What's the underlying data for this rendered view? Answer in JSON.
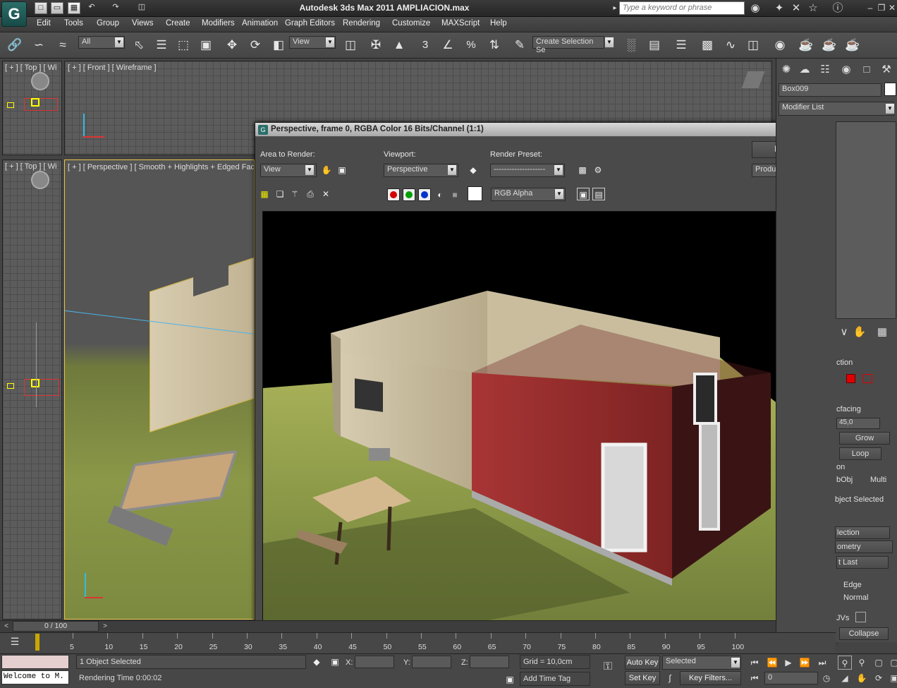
{
  "app": {
    "title": "Autodesk 3ds Max  2011      AMPLIACION.max",
    "logo_glyph": "G",
    "search_placeholder": "Type a keyword or phrase"
  },
  "menu": [
    "Edit",
    "Tools",
    "Group",
    "Views",
    "Create",
    "Modifiers",
    "Animation",
    "Graph Editors",
    "Rendering",
    "Customize",
    "MAXScript",
    "Help"
  ],
  "toolbar": {
    "selection_filter": "All",
    "ref_coord": "View",
    "named_selection": "Create Selection Se",
    "snap_3": "3",
    "snap_percent": "%"
  },
  "viewports": {
    "top_left_label": "[ + ] [ Top ] [ Wi",
    "front_label": "[ + ] [ Front ] [ Wireframe ]",
    "left_label": "[ + ] [ Top ] [ Wi",
    "perspective_label": "[ + ] [ Perspective ] [ Smooth + Highlights + Edged Faces ]"
  },
  "render_frame": {
    "title": "Perspective, frame 0, RGBA Color 16 Bits/Channel (1:1)",
    "area_to_render_label": "Area to Render:",
    "area_to_render_value": "View",
    "viewport_label": "Viewport:",
    "viewport_value": "Perspective",
    "render_preset_label": "Render Preset:",
    "render_preset_value": "--------------------",
    "render_button": "Render",
    "production_value": "Production",
    "channel_value": "RGB Alpha"
  },
  "command_panel": {
    "object_name": "Box009",
    "modifier_list": "Modifier List",
    "selection_rollout": "ction",
    "backfacing": "cfacing",
    "threshold": "45,0",
    "grow": "Grow",
    "loop": "Loop",
    "on": "on",
    "by_obj": "bObj",
    "multi": "Multi",
    "object_selected": "bject Selected",
    "soft_selection": "lection",
    "edit_geometry": "ometry",
    "repeat_last": "t Last",
    "edge": "Edge",
    "normal": "Normal",
    "uvs": "JVs",
    "collapse": "Collapse"
  },
  "timeline": {
    "frame_counter": "0 / 100",
    "ticks": [
      "5",
      "10",
      "15",
      "20",
      "25",
      "30",
      "35",
      "40",
      "45",
      "50",
      "55",
      "60",
      "65",
      "70",
      "75",
      "80",
      "85",
      "90",
      "95",
      "100"
    ]
  },
  "status": {
    "maxscript_listener": "Welcome to M.",
    "selection_status": "1 Object Selected",
    "rendering_time": "Rendering Time  0:00:02",
    "x_label": "X:",
    "y_label": "Y:",
    "z_label": "Z:",
    "grid": "Grid = 10,0cm",
    "add_time_tag": "Add Time Tag",
    "auto_key": "Auto Key",
    "set_key": "Set Key",
    "key_mode": "Selected",
    "key_filters": "Key Filters...",
    "current_frame": "0"
  },
  "colors": {
    "accent_red": "#d40000",
    "accent_green": "#00a000",
    "accent_blue": "#0033cc",
    "brick": "#9a2d2d",
    "wood": "#c8b89a",
    "grass": "#8c9a48"
  }
}
